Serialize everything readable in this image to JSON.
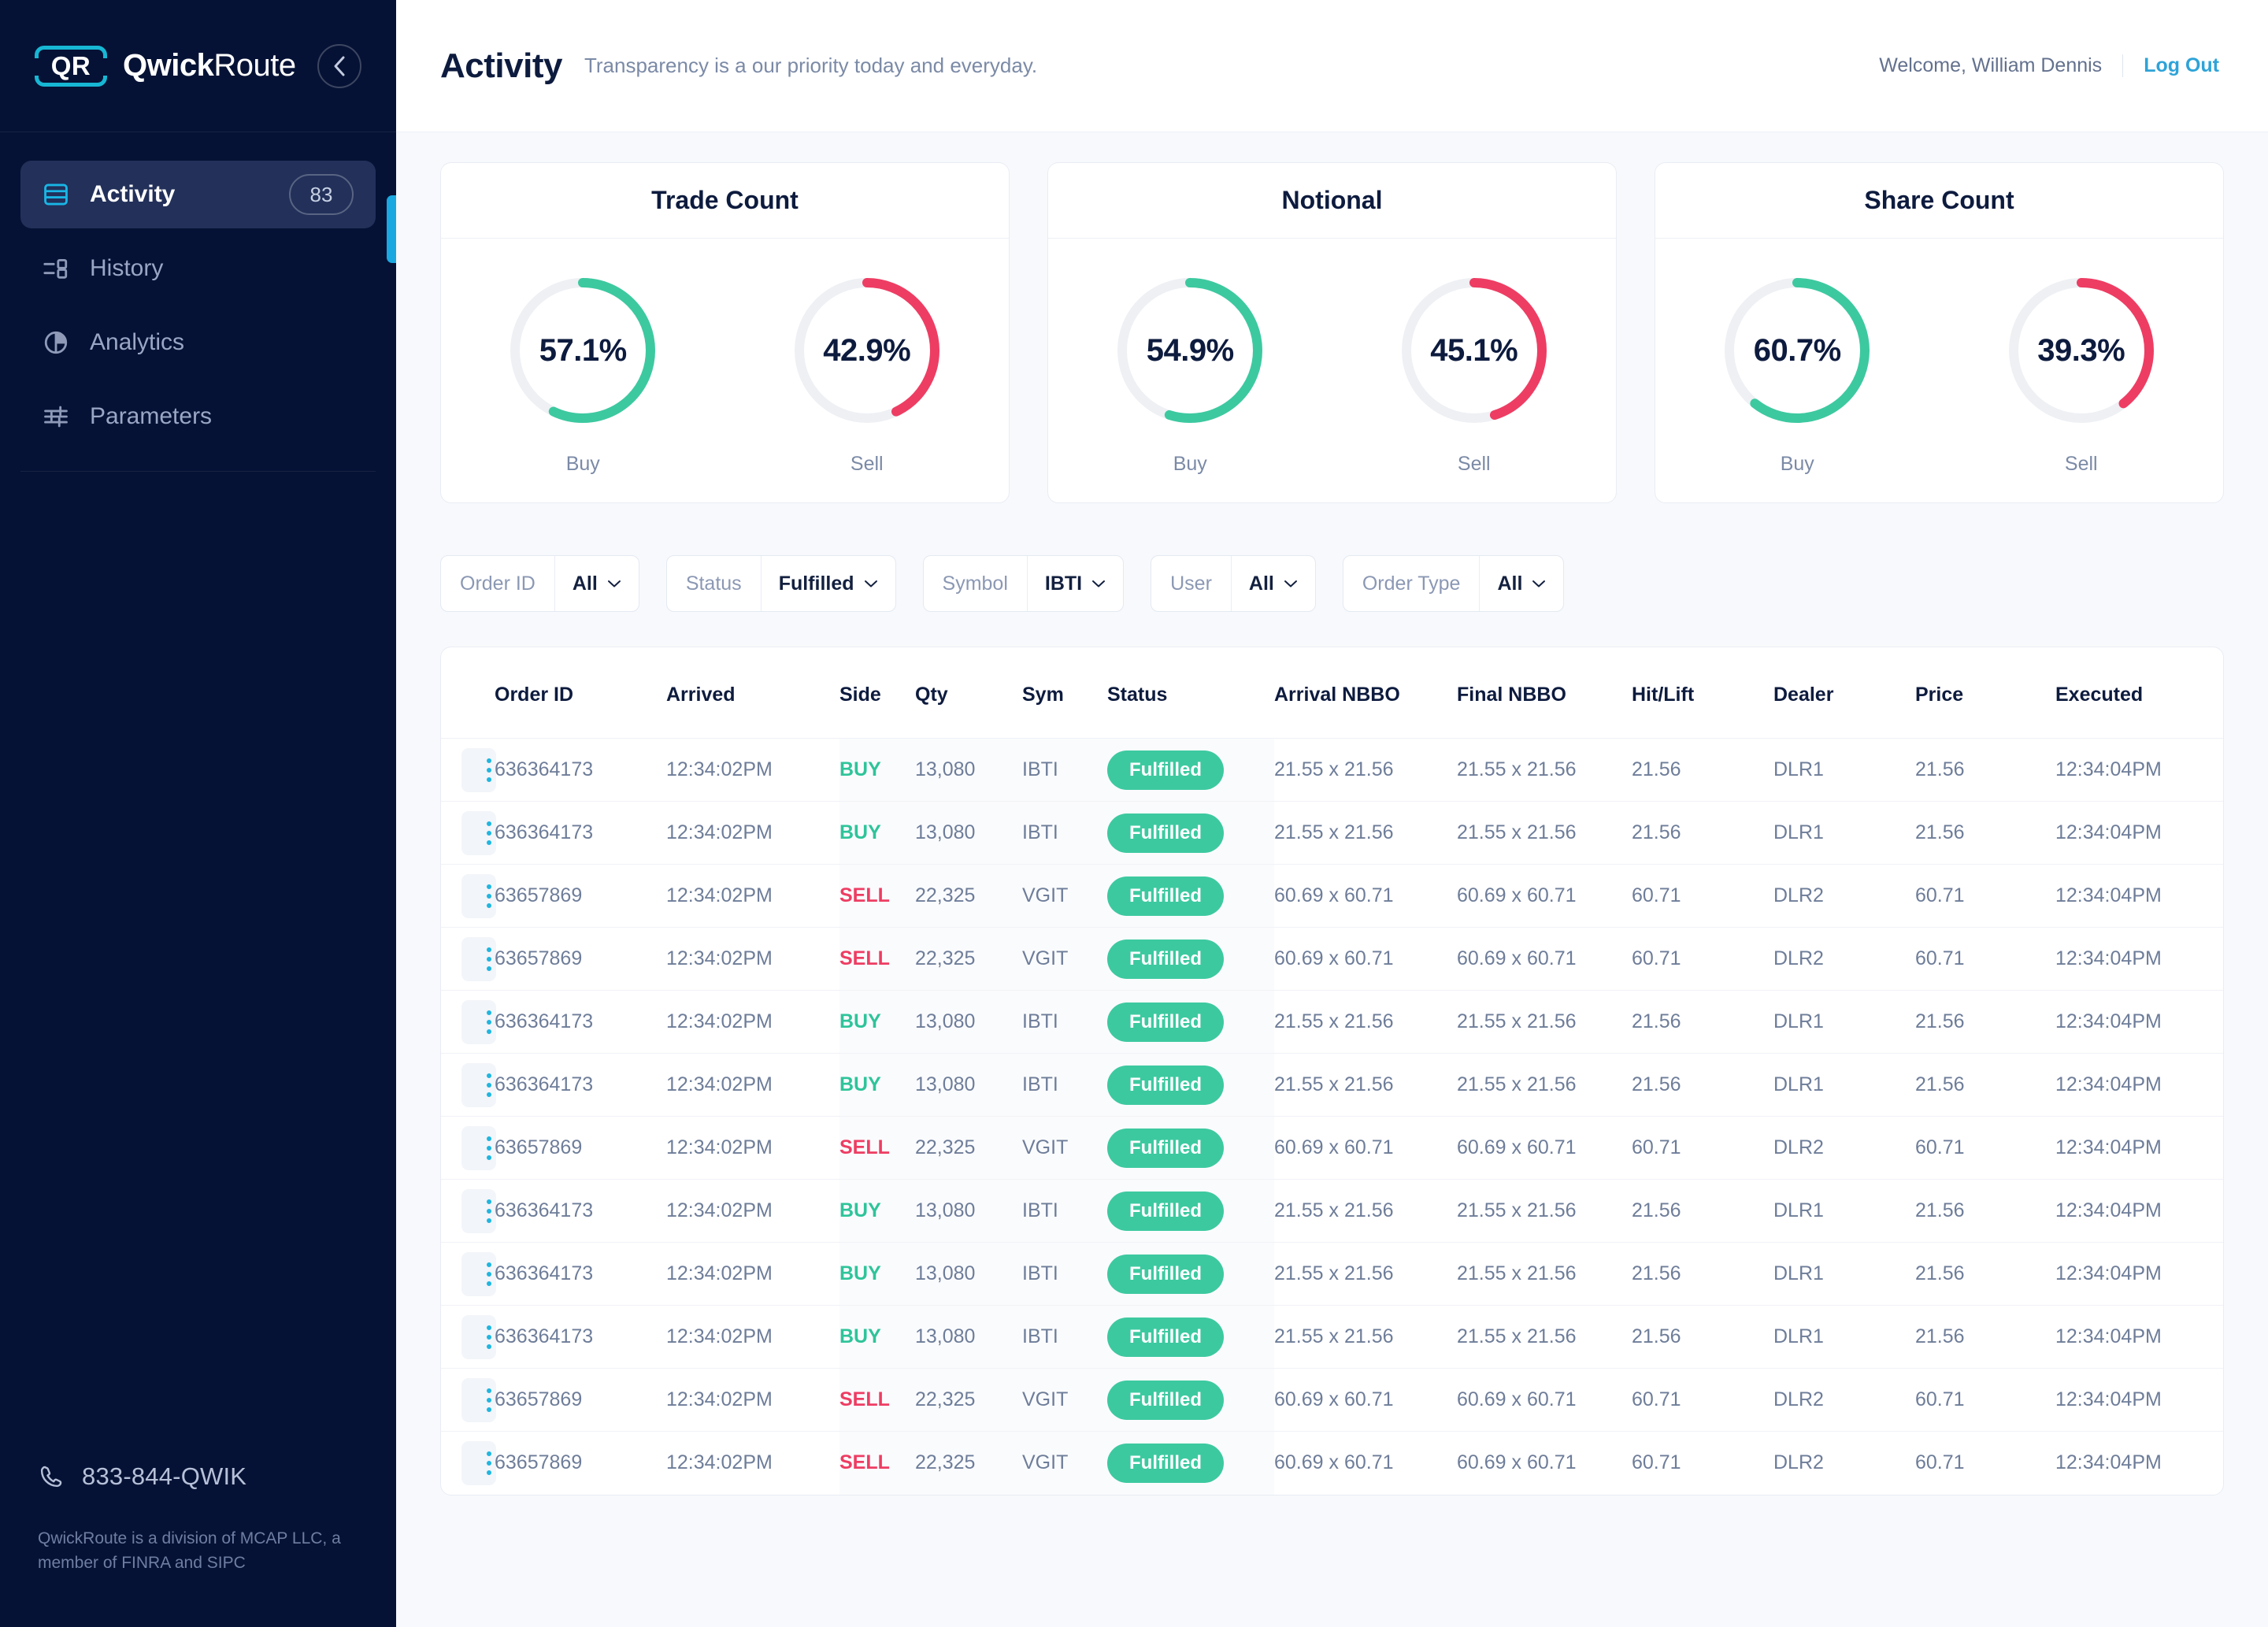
{
  "brand": {
    "logo_text": "QR",
    "name_bold": "Qwick",
    "name_light": "Route"
  },
  "sidebar": {
    "collapse_icon": "chevron-left-icon",
    "items": [
      {
        "label": "Activity",
        "icon": "table-rows-icon",
        "badge": "83",
        "active": true
      },
      {
        "label": "History",
        "icon": "queue-list-icon",
        "badge": "",
        "active": false
      },
      {
        "label": "Analytics",
        "icon": "pie-chart-icon",
        "badge": "",
        "active": false
      },
      {
        "label": "Parameters",
        "icon": "sliders-icon",
        "badge": "",
        "active": false
      }
    ],
    "footer": {
      "phone_icon": "phone-icon",
      "phone": "833-844-QWIK",
      "legal": "QwickRoute is a division of MCAP LLC, a member of FINRA and SIPC"
    }
  },
  "header": {
    "title": "Activity",
    "subtitle": "Transparency is a our priority today and everyday.",
    "welcome": "Welcome, William Dennis",
    "logout": "Log Out"
  },
  "colors": {
    "buy": "#3dc9a0",
    "sell": "#ee3d63",
    "track": "#eef0f4",
    "accent": "#1aa8e0",
    "sidebar_bg": "#061235"
  },
  "chart_data": [
    {
      "type": "pie",
      "title": "Trade Count",
      "categories": [
        "Buy",
        "Sell"
      ],
      "values": [
        57.1,
        42.9
      ],
      "labels": [
        "57.1%",
        "42.9%"
      ],
      "colors": [
        "#3dc9a0",
        "#ee3d63"
      ],
      "legend": "below-each-donut"
    },
    {
      "type": "pie",
      "title": "Notional",
      "categories": [
        "Buy",
        "Sell"
      ],
      "values": [
        54.9,
        45.1
      ],
      "labels": [
        "54.9%",
        "45.1%"
      ],
      "colors": [
        "#3dc9a0",
        "#ee3d63"
      ],
      "legend": "below-each-donut"
    },
    {
      "type": "pie",
      "title": "Share Count",
      "categories": [
        "Buy",
        "Sell"
      ],
      "values": [
        60.7,
        39.3
      ],
      "labels": [
        "60.7%",
        "39.3%"
      ],
      "colors": [
        "#3dc9a0",
        "#ee3d63"
      ],
      "legend": "below-each-donut"
    }
  ],
  "filters": [
    {
      "label": "Order ID",
      "value": "All"
    },
    {
      "label": "Status",
      "value": "Fulfilled"
    },
    {
      "label": "Symbol",
      "value": "IBTI"
    },
    {
      "label": "User",
      "value": "All"
    },
    {
      "label": "Order Type",
      "value": "All"
    }
  ],
  "table": {
    "columns": [
      "Order ID",
      "Arrived",
      "Side",
      "Qty",
      "Sym",
      "Status",
      "Arrival NBBO",
      "Final NBBO",
      "Hit/Lift",
      "Dealer",
      "Price",
      "Executed"
    ],
    "rows": [
      {
        "order_id": "636364173",
        "arrived": "12:34:02PM",
        "side": "BUY",
        "qty": "13,080",
        "sym": "IBTI",
        "status": "Fulfilled",
        "arrival_nbbo": "21.55 x 21.56",
        "final_nbbo": "21.55 x 21.56",
        "hit_lift": "21.56",
        "dealer": "DLR1",
        "price": "21.56",
        "executed": "12:34:04PM"
      },
      {
        "order_id": "636364173",
        "arrived": "12:34:02PM",
        "side": "BUY",
        "qty": "13,080",
        "sym": "IBTI",
        "status": "Fulfilled",
        "arrival_nbbo": "21.55 x 21.56",
        "final_nbbo": "21.55 x 21.56",
        "hit_lift": "21.56",
        "dealer": "DLR1",
        "price": "21.56",
        "executed": "12:34:04PM"
      },
      {
        "order_id": "63657869",
        "arrived": "12:34:02PM",
        "side": "SELL",
        "qty": "22,325",
        "sym": "VGIT",
        "status": "Fulfilled",
        "arrival_nbbo": "60.69 x 60.71",
        "final_nbbo": "60.69 x 60.71",
        "hit_lift": "60.71",
        "dealer": "DLR2",
        "price": "60.71",
        "executed": "12:34:04PM"
      },
      {
        "order_id": "63657869",
        "arrived": "12:34:02PM",
        "side": "SELL",
        "qty": "22,325",
        "sym": "VGIT",
        "status": "Fulfilled",
        "arrival_nbbo": "60.69 x 60.71",
        "final_nbbo": "60.69 x 60.71",
        "hit_lift": "60.71",
        "dealer": "DLR2",
        "price": "60.71",
        "executed": "12:34:04PM"
      },
      {
        "order_id": "636364173",
        "arrived": "12:34:02PM",
        "side": "BUY",
        "qty": "13,080",
        "sym": "IBTI",
        "status": "Fulfilled",
        "arrival_nbbo": "21.55 x 21.56",
        "final_nbbo": "21.55 x 21.56",
        "hit_lift": "21.56",
        "dealer": "DLR1",
        "price": "21.56",
        "executed": "12:34:04PM"
      },
      {
        "order_id": "636364173",
        "arrived": "12:34:02PM",
        "side": "BUY",
        "qty": "13,080",
        "sym": "IBTI",
        "status": "Fulfilled",
        "arrival_nbbo": "21.55 x 21.56",
        "final_nbbo": "21.55 x 21.56",
        "hit_lift": "21.56",
        "dealer": "DLR1",
        "price": "21.56",
        "executed": "12:34:04PM"
      },
      {
        "order_id": "63657869",
        "arrived": "12:34:02PM",
        "side": "SELL",
        "qty": "22,325",
        "sym": "VGIT",
        "status": "Fulfilled",
        "arrival_nbbo": "60.69 x 60.71",
        "final_nbbo": "60.69 x 60.71",
        "hit_lift": "60.71",
        "dealer": "DLR2",
        "price": "60.71",
        "executed": "12:34:04PM"
      },
      {
        "order_id": "636364173",
        "arrived": "12:34:02PM",
        "side": "BUY",
        "qty": "13,080",
        "sym": "IBTI",
        "status": "Fulfilled",
        "arrival_nbbo": "21.55 x 21.56",
        "final_nbbo": "21.55 x 21.56",
        "hit_lift": "21.56",
        "dealer": "DLR1",
        "price": "21.56",
        "executed": "12:34:04PM"
      },
      {
        "order_id": "636364173",
        "arrived": "12:34:02PM",
        "side": "BUY",
        "qty": "13,080",
        "sym": "IBTI",
        "status": "Fulfilled",
        "arrival_nbbo": "21.55 x 21.56",
        "final_nbbo": "21.55 x 21.56",
        "hit_lift": "21.56",
        "dealer": "DLR1",
        "price": "21.56",
        "executed": "12:34:04PM"
      },
      {
        "order_id": "636364173",
        "arrived": "12:34:02PM",
        "side": "BUY",
        "qty": "13,080",
        "sym": "IBTI",
        "status": "Fulfilled",
        "arrival_nbbo": "21.55 x 21.56",
        "final_nbbo": "21.55 x 21.56",
        "hit_lift": "21.56",
        "dealer": "DLR1",
        "price": "21.56",
        "executed": "12:34:04PM"
      },
      {
        "order_id": "63657869",
        "arrived": "12:34:02PM",
        "side": "SELL",
        "qty": "22,325",
        "sym": "VGIT",
        "status": "Fulfilled",
        "arrival_nbbo": "60.69 x 60.71",
        "final_nbbo": "60.69 x 60.71",
        "hit_lift": "60.71",
        "dealer": "DLR2",
        "price": "60.71",
        "executed": "12:34:04PM"
      },
      {
        "order_id": "63657869",
        "arrived": "12:34:02PM",
        "side": "SELL",
        "qty": "22,325",
        "sym": "VGIT",
        "status": "Fulfilled",
        "arrival_nbbo": "60.69 x 60.71",
        "final_nbbo": "60.69 x 60.71",
        "hit_lift": "60.71",
        "dealer": "DLR2",
        "price": "60.71",
        "executed": "12:34:04PM"
      }
    ]
  }
}
